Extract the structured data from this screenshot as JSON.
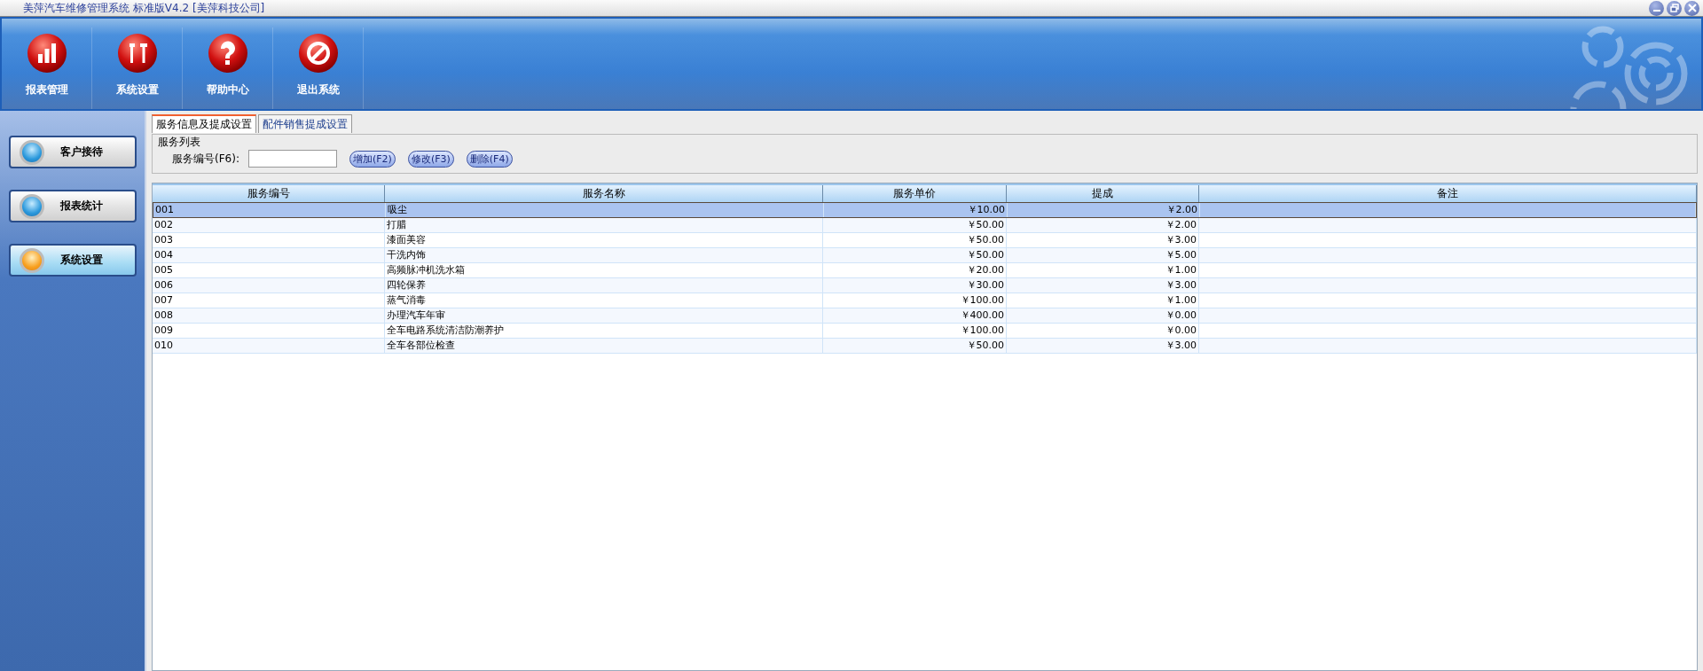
{
  "window": {
    "title": "美萍汽车维修管理系统 标准版V4.2 [美萍科技公司]"
  },
  "toolbar": [
    {
      "label": "报表管理",
      "kind": "chart"
    },
    {
      "label": "系统设置",
      "kind": "tools"
    },
    {
      "label": "帮助中心",
      "kind": "help"
    },
    {
      "label": "退出系统",
      "kind": "exit"
    }
  ],
  "sidebar": {
    "items": [
      {
        "label": "客户接待",
        "selected": false
      },
      {
        "label": "报表统计",
        "selected": false
      },
      {
        "label": "系统设置",
        "selected": true
      }
    ]
  },
  "tabs": [
    {
      "label": "服务信息及提成设置",
      "selected": true
    },
    {
      "label": "配件销售提成设置",
      "selected": false
    }
  ],
  "group": {
    "title": "服务列表",
    "search_label": "服务编号(F6):",
    "buttons": [
      "增加(F2)",
      "修改(F3)",
      "删除(F4)"
    ]
  },
  "table": {
    "columns": [
      "服务编号",
      "服务名称",
      "服务单价",
      "提成",
      "备注"
    ],
    "rows": [
      {
        "cells": [
          "001",
          "吸尘",
          "￥10.00",
          "￥2.00"
        ],
        "selected": true
      },
      {
        "cells": [
          "002",
          "打腊",
          "￥50.00",
          "￥2.00"
        ],
        "selected": false
      },
      {
        "cells": [
          "003",
          "漆面美容",
          "￥50.00",
          "￥3.00"
        ],
        "selected": false
      },
      {
        "cells": [
          "004",
          "干洗内饰",
          "￥50.00",
          "￥5.00"
        ],
        "selected": false
      },
      {
        "cells": [
          "005",
          "高频脉冲机洗水箱",
          "￥20.00",
          "￥1.00"
        ],
        "selected": false
      },
      {
        "cells": [
          "006",
          "四轮保养",
          "￥30.00",
          "￥3.00"
        ],
        "selected": false
      },
      {
        "cells": [
          "007",
          "蒸气消毒",
          "￥100.00",
          "￥1.00"
        ],
        "selected": false
      },
      {
        "cells": [
          "008",
          "办理汽车年审",
          "￥400.00",
          "￥0.00"
        ],
        "selected": false
      },
      {
        "cells": [
          "009",
          "全车电路系统清洁防潮养护",
          "￥100.00",
          "￥0.00"
        ],
        "selected": false
      },
      {
        "cells": [
          "010",
          "全车各部位检查",
          "￥50.00",
          "￥3.00"
        ],
        "selected": false
      }
    ]
  }
}
